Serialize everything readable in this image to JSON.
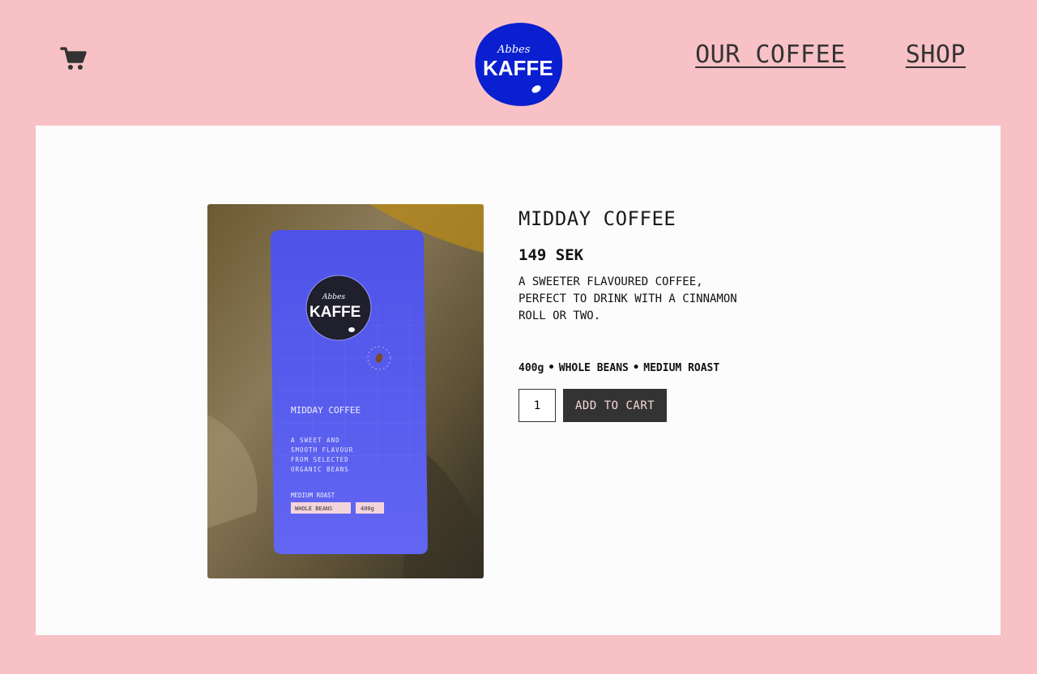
{
  "header": {
    "cart_icon": "cart-icon",
    "logo": {
      "small_text": "Abbes",
      "big_text": "KAFFE"
    },
    "nav": [
      {
        "label": "OUR COFFEE"
      },
      {
        "label": "SHOP"
      }
    ]
  },
  "product": {
    "title": "MIDDAY COFFEE",
    "price": "149 SEK",
    "description": "A SWEETER FLAVOURED COFFEE, PERFECT TO DRINK WITH A CINNAMON ROLL OR TWO.",
    "specs": [
      "400g",
      "WHOLE BEANS",
      "MEDIUM ROAST"
    ],
    "separator": "•",
    "quantity": "1",
    "add_to_cart_label": "ADD TO CART",
    "bag": {
      "logo_small": "Abbes",
      "logo_big": "KAFFE",
      "name": "MIDDAY COFFEE",
      "tagline_lines": [
        "A SWEET AND",
        "SMOOTH FLAVOUR",
        "FROM SELECTED",
        "ORGANIC BEANS"
      ],
      "roast": "MEDIUM ROAST",
      "tag_beans": "WHOLE BEANS",
      "tag_weight": "400g"
    }
  },
  "colors": {
    "background": "#f8c1c6",
    "panel": "#fcfcfc",
    "logo_blue": "#0a1fd0",
    "bag_blue": "#5a5ef0",
    "button": "#333333"
  }
}
